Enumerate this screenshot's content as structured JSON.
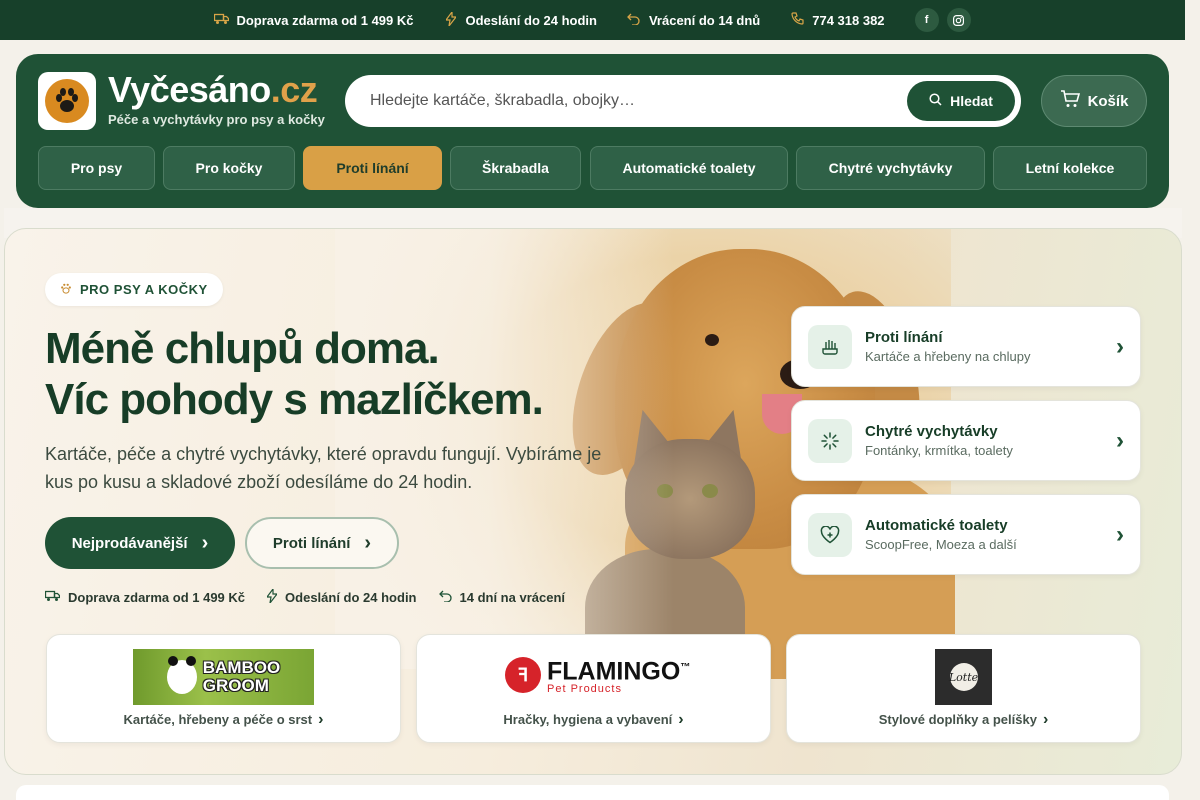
{
  "topbar": {
    "shipping": "Doprava zdarma od 1 499 Kč",
    "dispatch": "Odeslání do 24 hodin",
    "returns": "Vrácení do 14 dnů",
    "phone": "774 318 382",
    "facebook": "f",
    "instagram": "◎"
  },
  "brand": {
    "name": "Vyčesáno",
    "tld": ".cz",
    "tagline": "Péče a vychytávky pro psy a kočky"
  },
  "search": {
    "placeholder": "Hledejte kartáče, škrabadla, obojky…",
    "button": "Hledat"
  },
  "cart": {
    "label": "Košík"
  },
  "nav": [
    {
      "label": "Pro psy",
      "active": false
    },
    {
      "label": "Pro kočky",
      "active": false
    },
    {
      "label": "Proti línání",
      "active": true
    },
    {
      "label": "Škrabadla",
      "active": false
    },
    {
      "label": "Automatické toalety",
      "active": false
    },
    {
      "label": "Chytré vychytávky",
      "active": false
    },
    {
      "label": "Letní kolekce",
      "active": false
    }
  ],
  "hero": {
    "badge": "PRO PSY A KOČKY",
    "headline_line1": "Méně chlupů doma.",
    "headline_line2": "Víc pohody s mazlíčkem.",
    "subtext": "Kartáče, péče a chytré vychytávky, které opravdu fungují. Vybíráme je kus po kusu a skladové zboží odesíláme do 24 hodin.",
    "primary_button": "Nejprodávanější",
    "secondary_button": "Proti línání",
    "perks": [
      "Doprava zdarma od 1 499 Kč",
      "Odeslání do 24 hodin",
      "14 dní na vrácení"
    ]
  },
  "categories": [
    {
      "title": "Proti línání",
      "subtitle": "Kartáče a hřebeny na chlupy",
      "icon": "brush-icon"
    },
    {
      "title": "Chytré vychytávky",
      "subtitle": "Fontánky, krmítka, toalety",
      "icon": "sparkle-icon"
    },
    {
      "title": "Automatické toalety",
      "subtitle": "ScoopFree, Moeza a další",
      "icon": "heart-plus-icon"
    }
  ],
  "brands": [
    {
      "logo_text_1": "BAMBOO",
      "logo_text_2": "GROOM",
      "description": "Kartáče, hřebeny a péče o srst"
    },
    {
      "logo_text_1": "FLAMINGO",
      "logo_text_2": "Pet Products",
      "description": "Hračky, hygiena a vybavení"
    },
    {
      "logo_text_1": "Lotte",
      "description": "Stylové doplňky a pelíšky"
    }
  ],
  "colors": {
    "primary": "#1f5236",
    "topbar": "#17402a",
    "accent": "#d9a046",
    "tld": "#e0a14a"
  }
}
